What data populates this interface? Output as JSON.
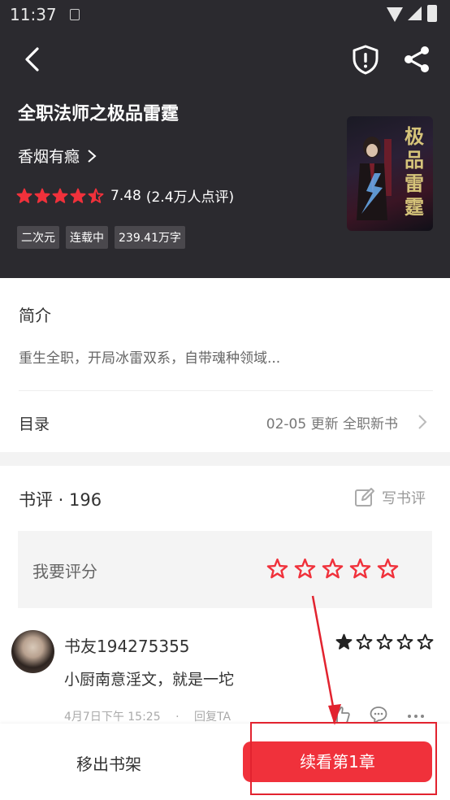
{
  "status_bar": {
    "time": "11:37"
  },
  "book": {
    "title": "全职法师之极品雷霆",
    "author": "香烟有瘾",
    "rating": {
      "stars_filled": 4.5,
      "stars_total": 5,
      "score": "7.48",
      "count": "(2.4万人点评)"
    },
    "tags": [
      "二次元",
      "连载中",
      "239.41万字"
    ],
    "cover": {
      "glyphs": [
        "极",
        "品",
        "雷",
        "霆"
      ]
    }
  },
  "intro": {
    "heading": "简介",
    "text": "重生全职，开局冰雷双系，自带魂种领域..."
  },
  "toc": {
    "label": "目录",
    "update": "02-05  更新  全职新书"
  },
  "reviews": {
    "heading": "书评 · 196",
    "write_label": "写书评",
    "rate_prompt": "我要评分",
    "comment": {
      "user": "书友194275355",
      "stars_filled": 1,
      "text": "小厨南意淫文，就是一坨",
      "date": "4月7日下午 15:25",
      "dot": "·",
      "reply": "回复TA"
    }
  },
  "bottom_bar": {
    "remove_label": "移出书架",
    "continue_label": "续看第1章"
  },
  "colors": {
    "accent": "#f0313b",
    "header_bg": "#2b2a2f",
    "annotation": "#e2232f"
  },
  "icons": [
    "back-icon",
    "shield-icon",
    "share-icon",
    "chevron-right-icon",
    "star-icon",
    "edit-icon",
    "like-icon",
    "comment-icon",
    "more-icon"
  ]
}
